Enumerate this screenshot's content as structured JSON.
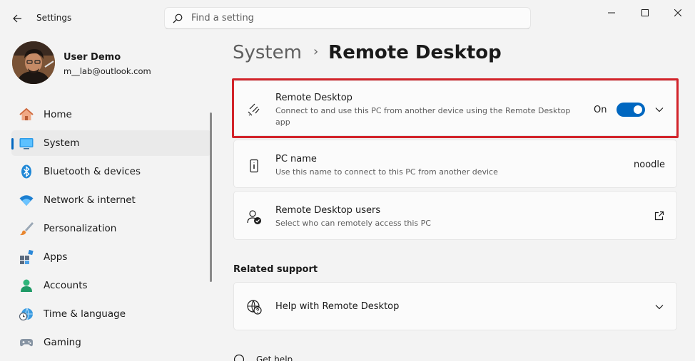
{
  "window": {
    "title": "Settings",
    "controls": [
      "minimize",
      "maximize",
      "close"
    ]
  },
  "search": {
    "placeholder": "Find a setting"
  },
  "user": {
    "name": "User Demo",
    "email": "m__lab@outlook.com"
  },
  "sidebar": {
    "items": [
      {
        "label": "Home",
        "icon": "home-icon",
        "active": false
      },
      {
        "label": "System",
        "icon": "system-icon",
        "active": true
      },
      {
        "label": "Bluetooth & devices",
        "icon": "bluetooth-icon",
        "active": false
      },
      {
        "label": "Network & internet",
        "icon": "wifi-icon",
        "active": false
      },
      {
        "label": "Personalization",
        "icon": "brush-icon",
        "active": false
      },
      {
        "label": "Apps",
        "icon": "apps-icon",
        "active": false
      },
      {
        "label": "Accounts",
        "icon": "person-icon",
        "active": false
      },
      {
        "label": "Time & language",
        "icon": "clock-globe-icon",
        "active": false
      },
      {
        "label": "Gaming",
        "icon": "gamepad-icon",
        "active": false
      }
    ]
  },
  "breadcrumb": {
    "parent": "System",
    "separator": "›",
    "current": "Remote Desktop"
  },
  "cards": {
    "remote_desktop": {
      "title": "Remote Desktop",
      "description": "Connect to and use this PC from another device using the Remote Desktop app",
      "state_label": "On",
      "enabled": true
    },
    "pc_name": {
      "title": "PC name",
      "description": "Use this name to connect to this PC from another device",
      "value": "noodle"
    },
    "users": {
      "title": "Remote Desktop users",
      "description": "Select who can remotely access this PC"
    }
  },
  "related_support": {
    "heading": "Related support",
    "help_title": "Help with Remote Desktop"
  },
  "footer": {
    "get_help": "Get help"
  },
  "colors": {
    "accent": "#0067c0",
    "highlight_border": "#d2232a",
    "background": "#f3f3f3",
    "card": "#fbfbfb"
  }
}
